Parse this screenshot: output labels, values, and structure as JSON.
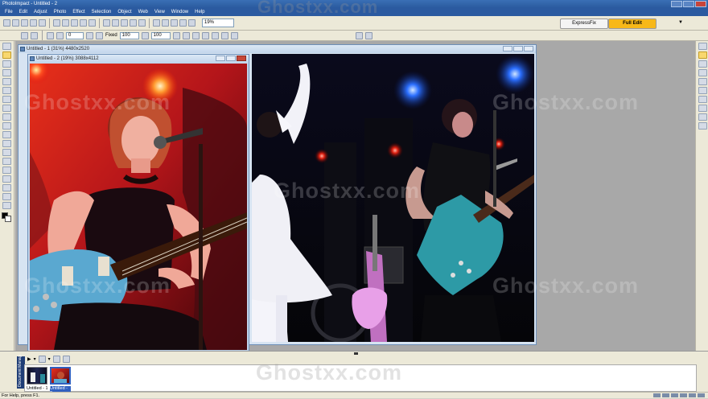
{
  "app": {
    "title": "PhotoImpact - Untitled - 2"
  },
  "menu": [
    "File",
    "Edit",
    "Adjust",
    "Photo",
    "Effect",
    "Selection",
    "Object",
    "Web",
    "View",
    "Window",
    "Help"
  ],
  "toolbar": {
    "zoom": "19%",
    "mode_tabs": {
      "express": "ExpressFix",
      "full": "Full Edit"
    }
  },
  "attribute_bar": {
    "value1": "0",
    "fixed_label": "Fixed",
    "width": "100",
    "height": "100"
  },
  "windows": [
    {
      "title": "Untitled - 1 (31%) 4480x2520"
    },
    {
      "title": "Untitled - 2 (19%) 3088x4112"
    }
  ],
  "organizer": {
    "side_label": "Document Manager",
    "thumbnails": [
      {
        "label": "Untitled - 1"
      },
      {
        "label": "Untitled - 2"
      }
    ]
  },
  "status": {
    "text": "For Help, press F1."
  },
  "watermark": "Ghostxx.com",
  "colors": {
    "accent": "#f7b818",
    "title_blue": "#2b5aa0"
  }
}
